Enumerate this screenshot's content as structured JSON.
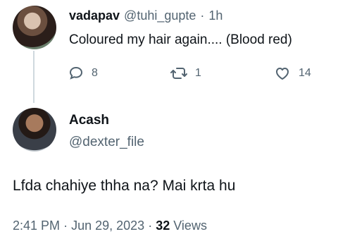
{
  "parent_tweet": {
    "display_name": "vadapav",
    "handle": "@tuhi_gupte",
    "separator": "·",
    "time_ago": "1h",
    "text": "Coloured my hair again.... (Blood red)",
    "actions": {
      "replies": "8",
      "retweets": "1",
      "likes": "14"
    },
    "icons": {
      "reply": "reply-icon",
      "retweet": "retweet-icon",
      "like": "heart-icon"
    }
  },
  "reply_tweet": {
    "display_name": "Acash",
    "handle": "@dexter_file",
    "text": "Lfda chahiye thha na? Mai krta hu",
    "time": "2:41 PM",
    "date": "Jun 29, 2023",
    "views_count": "32",
    "views_label": "Views",
    "sep": "·"
  },
  "colors": {
    "text_primary": "#0f1419",
    "text_muted": "#536471",
    "thread_line": "#cfd9de"
  }
}
